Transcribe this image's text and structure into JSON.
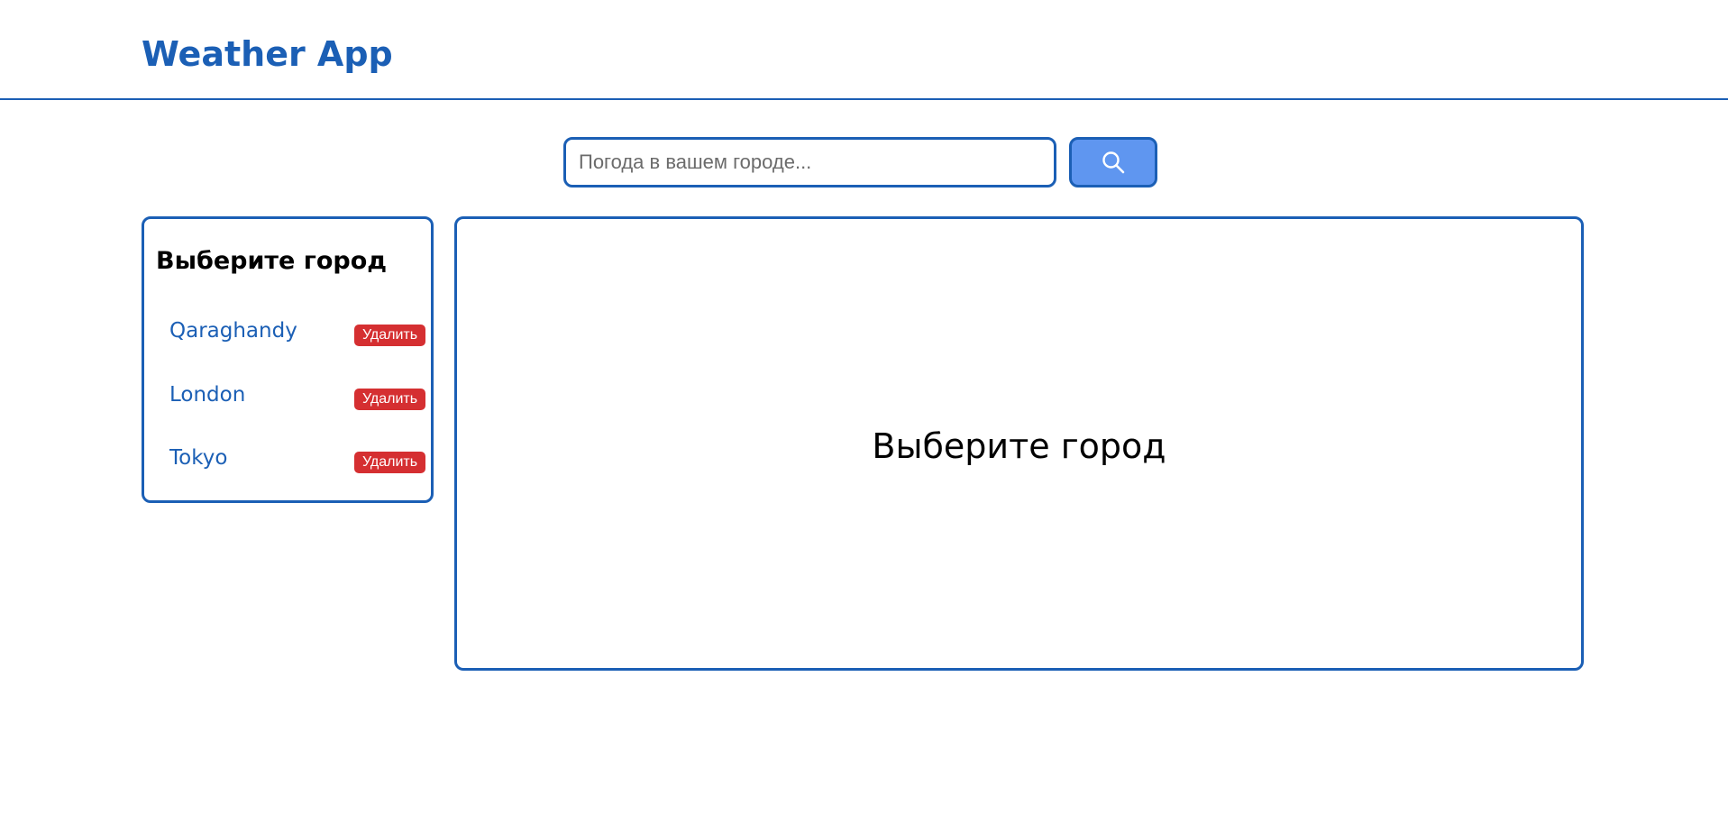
{
  "header": {
    "title": "Weather App"
  },
  "search": {
    "placeholder": "Погода в вашем городе...",
    "value": "",
    "button_icon": "search-icon"
  },
  "sidebar": {
    "title": "Выберите город",
    "cities": [
      {
        "name": "Qaraghandy",
        "delete_label": "Удалить"
      },
      {
        "name": "London",
        "delete_label": "Удалить"
      },
      {
        "name": "Tokyo",
        "delete_label": "Удалить"
      }
    ]
  },
  "main": {
    "message": "Выберите город"
  },
  "colors": {
    "accent": "#1b5fb5",
    "search_button": "#5f96f0",
    "delete_button": "#d52f31",
    "background": "#ffffff"
  }
}
